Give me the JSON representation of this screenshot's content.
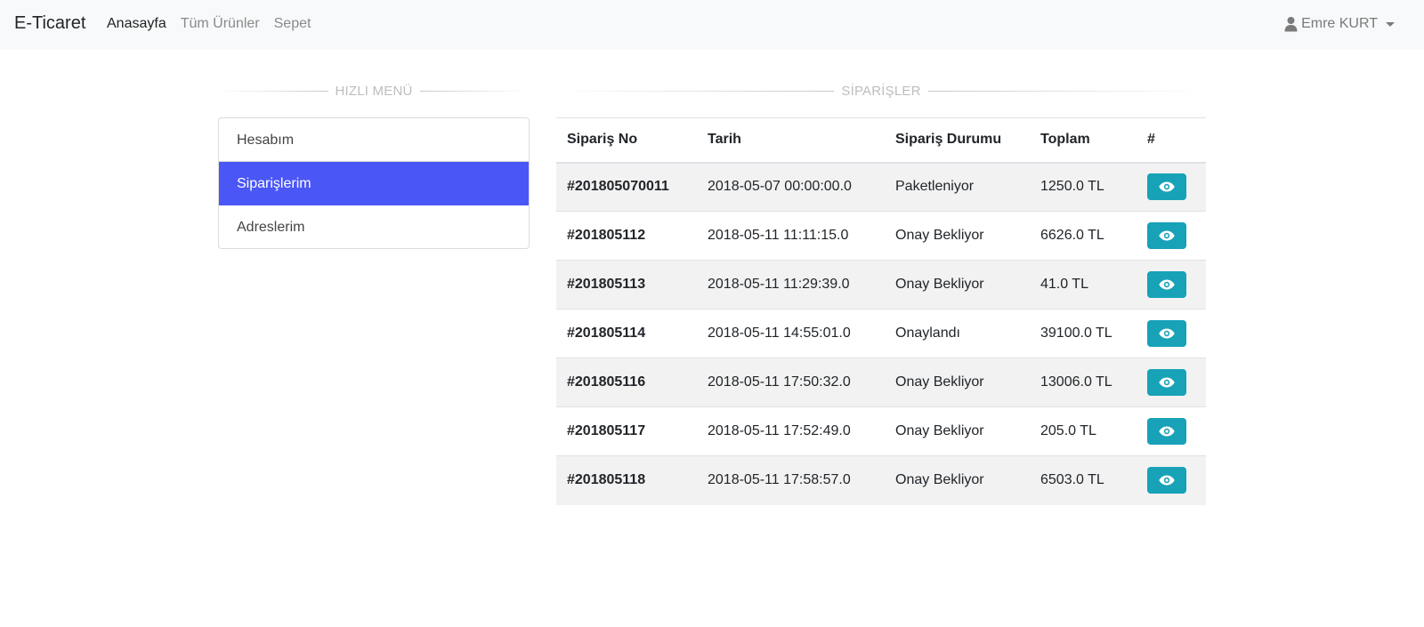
{
  "navbar": {
    "brand": "E-Ticaret",
    "links": [
      {
        "label": "Anasayfa"
      },
      {
        "label": "Tüm Ürünler"
      },
      {
        "label": "Sepet"
      }
    ],
    "user": {
      "name": "Emre KURT",
      "icon": "user-icon"
    }
  },
  "quick_menu": {
    "title": "HIZLI MENÜ",
    "items": [
      {
        "label": "Hesabım"
      },
      {
        "label": "Siparişlerim"
      },
      {
        "label": "Adreslerim"
      }
    ]
  },
  "orders": {
    "title": "SİPARİŞLER",
    "columns": [
      "Sipariş No",
      "Tarih",
      "Sipariş Durumu",
      "Toplam",
      "#"
    ],
    "rows": [
      {
        "no": "#201805070011",
        "date": "2018-05-07 00:00:00.0",
        "status": "Paketleniyor",
        "total": "1250.0 TL"
      },
      {
        "no": "#201805112",
        "date": "2018-05-11 11:11:15.0",
        "status": "Onay Bekliyor",
        "total": "6626.0 TL"
      },
      {
        "no": "#201805113",
        "date": "2018-05-11 11:29:39.0",
        "status": "Onay Bekliyor",
        "total": "41.0 TL"
      },
      {
        "no": "#201805114",
        "date": "2018-05-11 14:55:01.0",
        "status": "Onaylandı",
        "total": "39100.0 TL"
      },
      {
        "no": "#201805116",
        "date": "2018-05-11 17:50:32.0",
        "status": "Onay Bekliyor",
        "total": "13006.0 TL"
      },
      {
        "no": "#201805117",
        "date": "2018-05-11 17:52:49.0",
        "status": "Onay Bekliyor",
        "total": "205.0 TL"
      },
      {
        "no": "#201805118",
        "date": "2018-05-11 17:58:57.0",
        "status": "Onay Bekliyor",
        "total": "6503.0 TL"
      }
    ],
    "action_icon": "eye-icon"
  },
  "colors": {
    "accent": "#4a56f5",
    "view_button": "#17a2b8",
    "navbar_bg": "#f8f9fa",
    "row_stripe": "#f2f2f2"
  }
}
